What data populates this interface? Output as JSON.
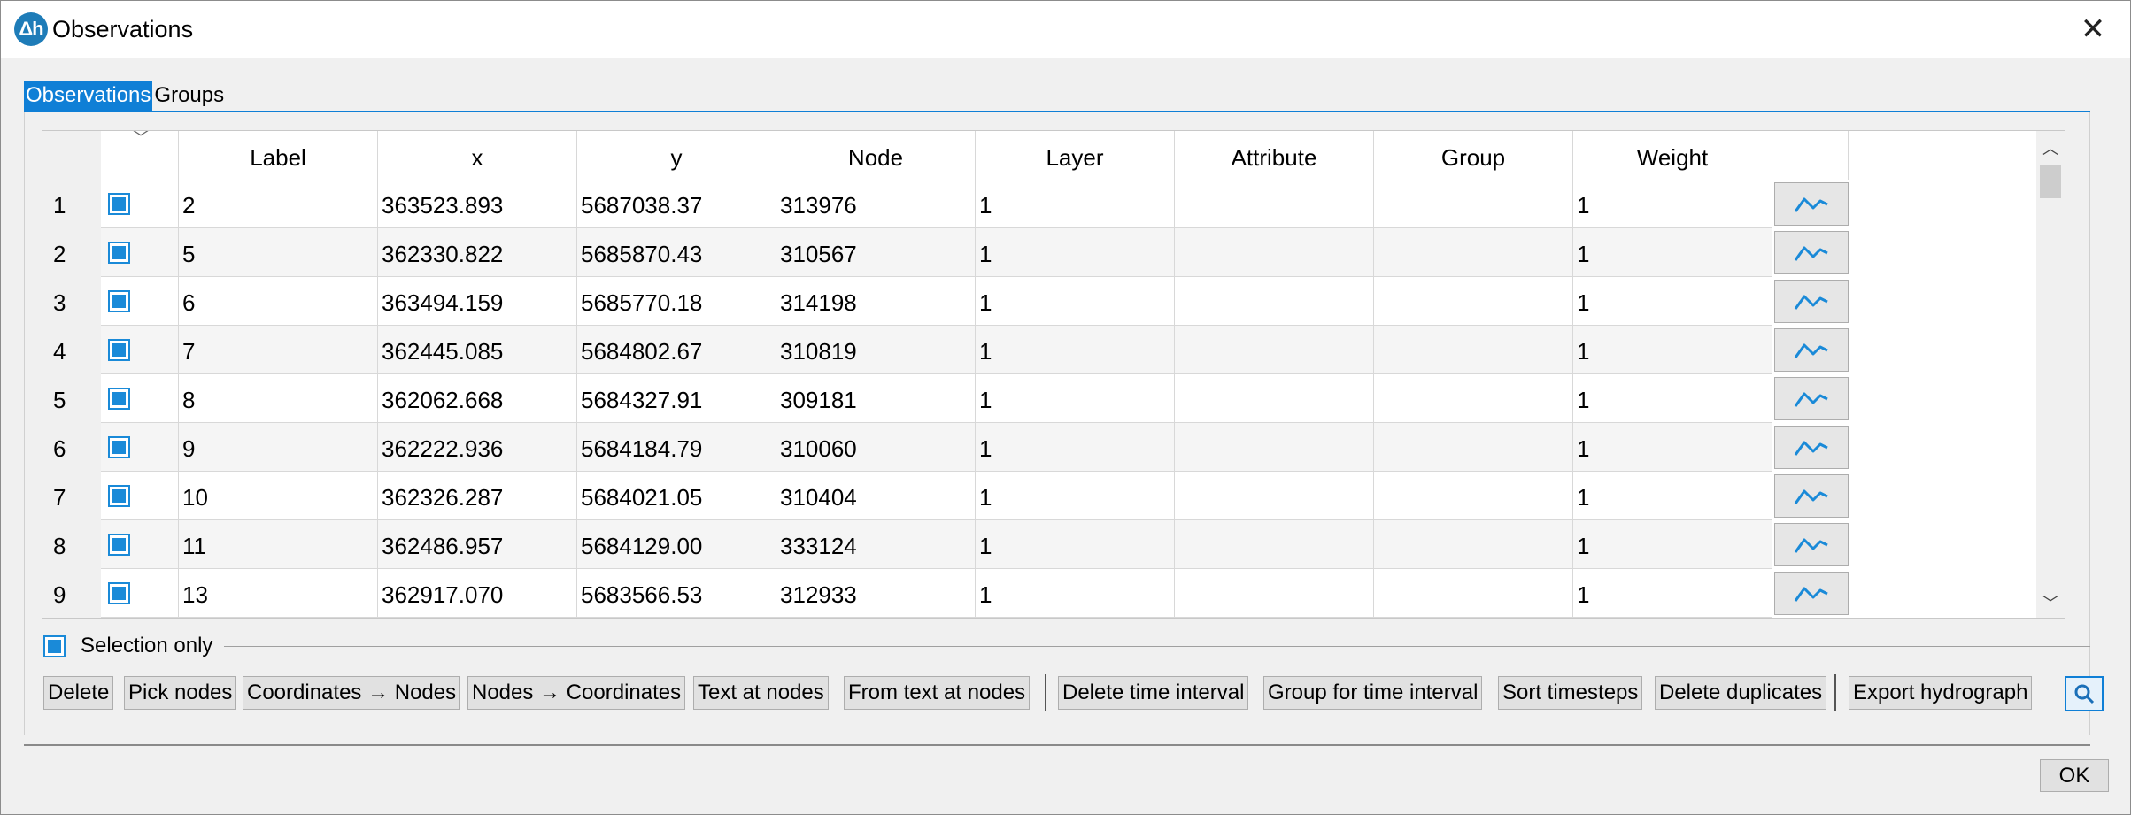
{
  "window": {
    "title": "Observations",
    "icon_text": "Δh"
  },
  "tabs": [
    {
      "label": "Observations",
      "active": true
    },
    {
      "label": "Groups",
      "active": false
    }
  ],
  "table": {
    "columns": [
      "Label",
      "x",
      "y",
      "Node",
      "Layer",
      "Attribute",
      "Group",
      "Weight"
    ],
    "rows": [
      {
        "num": "1",
        "checked": true,
        "label": "2",
        "x": "363523.893",
        "y": "5687038.37",
        "node": "313976",
        "layer": "1",
        "attribute": "",
        "group": "",
        "weight": "1"
      },
      {
        "num": "2",
        "checked": true,
        "label": "5",
        "x": "362330.822",
        "y": "5685870.43",
        "node": "310567",
        "layer": "1",
        "attribute": "",
        "group": "",
        "weight": "1"
      },
      {
        "num": "3",
        "checked": true,
        "label": "6",
        "x": "363494.159",
        "y": "5685770.18",
        "node": "314198",
        "layer": "1",
        "attribute": "",
        "group": "",
        "weight": "1"
      },
      {
        "num": "4",
        "checked": true,
        "label": "7",
        "x": "362445.085",
        "y": "5684802.67",
        "node": "310819",
        "layer": "1",
        "attribute": "",
        "group": "",
        "weight": "1"
      },
      {
        "num": "5",
        "checked": true,
        "label": "8",
        "x": "362062.668",
        "y": "5684327.91",
        "node": "309181",
        "layer": "1",
        "attribute": "",
        "group": "",
        "weight": "1"
      },
      {
        "num": "6",
        "checked": true,
        "label": "9",
        "x": "362222.936",
        "y": "5684184.79",
        "node": "310060",
        "layer": "1",
        "attribute": "",
        "group": "",
        "weight": "1"
      },
      {
        "num": "7",
        "checked": true,
        "label": "10",
        "x": "362326.287",
        "y": "5684021.05",
        "node": "310404",
        "layer": "1",
        "attribute": "",
        "group": "",
        "weight": "1"
      },
      {
        "num": "8",
        "checked": true,
        "label": "11",
        "x": "362486.957",
        "y": "5684129.00",
        "node": "333124",
        "layer": "1",
        "attribute": "",
        "group": "",
        "weight": "1"
      },
      {
        "num": "9",
        "checked": true,
        "label": "13",
        "x": "362917.070",
        "y": "5683566.53",
        "node": "312933",
        "layer": "1",
        "attribute": "",
        "group": "",
        "weight": "1"
      }
    ]
  },
  "selection_only": {
    "label": "Selection only",
    "checked": true
  },
  "buttons": {
    "delete": "Delete",
    "pick_nodes": "Pick nodes",
    "coords_to_nodes": "Coordinates → Nodes",
    "nodes_to_coords": "Nodes → Coordinates",
    "text_at_nodes": "Text at nodes",
    "from_text_at_nodes": "From text at nodes",
    "delete_time_interval": "Delete time interval",
    "group_for_time_interval": "Group for time interval",
    "sort_timesteps": "Sort timesteps",
    "delete_duplicates": "Delete duplicates",
    "export_hydrograph": "Export hydrograph"
  },
  "ok": "OK",
  "icons": {
    "close": "close-icon",
    "graph": "chart-line-icon",
    "search": "search-icon"
  },
  "colors": {
    "accent": "#0f7fd6",
    "checkbox": "#1a8ad8"
  }
}
